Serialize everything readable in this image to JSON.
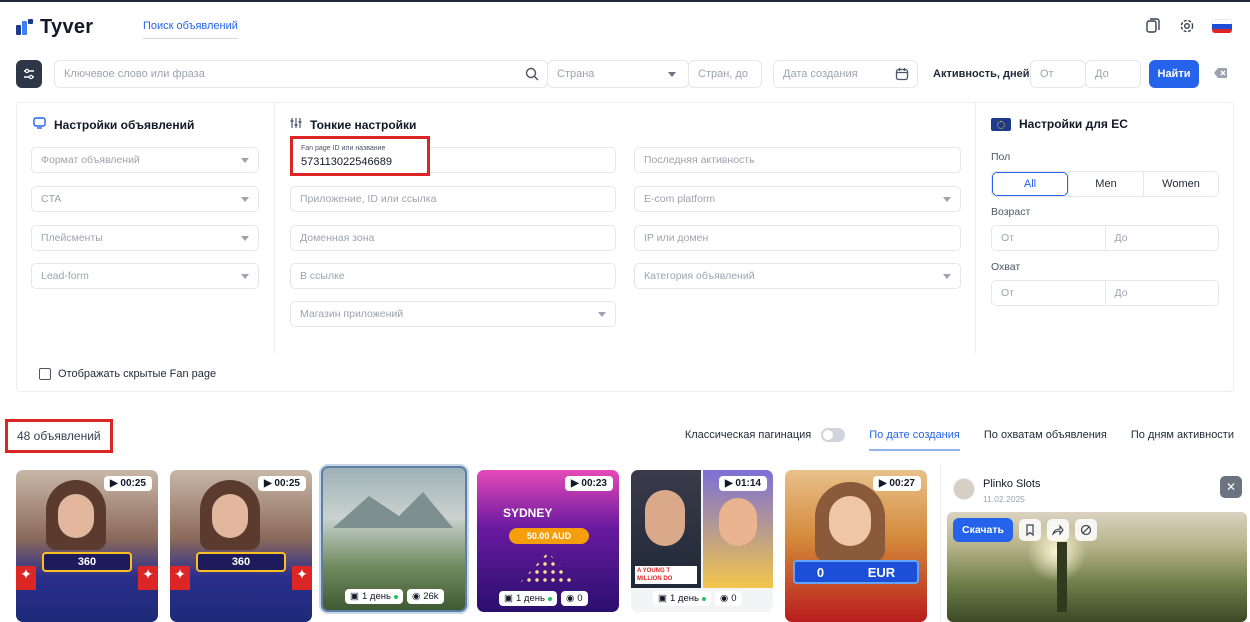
{
  "app": {
    "brand": "Tyver",
    "nav_link": "Поиск объявлений"
  },
  "search": {
    "keyword_placeholder": "Ключевое слово или фраза",
    "country_placeholder": "Страна",
    "countries_placeholder": "Стран, до",
    "created_date_placeholder": "Дата создания",
    "activity_label": "Активность, дней",
    "activity_from": "От",
    "activity_to": "До",
    "find_button": "Найти"
  },
  "settings": {
    "title": "Настройки объявлений",
    "fields": [
      "Формат объявлений",
      "CTA",
      "Плейсменты",
      "Lead-form"
    ]
  },
  "fine": {
    "title": "Тонкие настройки",
    "fanpage_label": "Fan page ID или название",
    "fanpage_value": "573113022546689",
    "fields_left": [
      "Приложение, ID или ссылка",
      "Доменная зона",
      "В ссылке",
      "Магазин приложений"
    ],
    "fields_right": [
      "Последняя активность",
      "E-com platform",
      "IP или домен",
      "Категория объявлений"
    ]
  },
  "eu": {
    "title": "Настройки для ЕС",
    "gender_label": "Пол",
    "gender_options": [
      "All",
      "Men",
      "Women"
    ],
    "age_label": "Возраст",
    "age_from": "От",
    "age_to": "До",
    "reach_label": "Охват",
    "reach_from": "От",
    "reach_to": "До"
  },
  "show_hidden": "Отображать скрытые Fan page",
  "results": {
    "count": "48 объявлений",
    "classic_pagination": "Классическая пагинация",
    "sort_options": [
      "По дате создания",
      "По охватам объявления",
      "По дням активности"
    ]
  },
  "cards": [
    {
      "duration": "00:25",
      "overlay": "360"
    },
    {
      "duration": "00:25",
      "overlay": "360"
    },
    {
      "days": "1 день",
      "views": "26k"
    },
    {
      "duration": "00:23",
      "overlay_title": "SYDNEY",
      "overlay_amount": "50.00 AUD",
      "days": "1 день",
      "views": "0"
    },
    {
      "duration": "01:14",
      "caption": "A YOUNG T MILLION DO",
      "days": "1 день",
      "views": "0"
    },
    {
      "duration": "00:27",
      "score": "0",
      "currency": "EUR"
    }
  ],
  "detail": {
    "name": "Plinko Slots",
    "date": "11.02.2025",
    "download": "Скачать"
  },
  "colors": {
    "accent": "#2563eb",
    "highlight": "#dc2626",
    "dark": "#2d3748"
  }
}
